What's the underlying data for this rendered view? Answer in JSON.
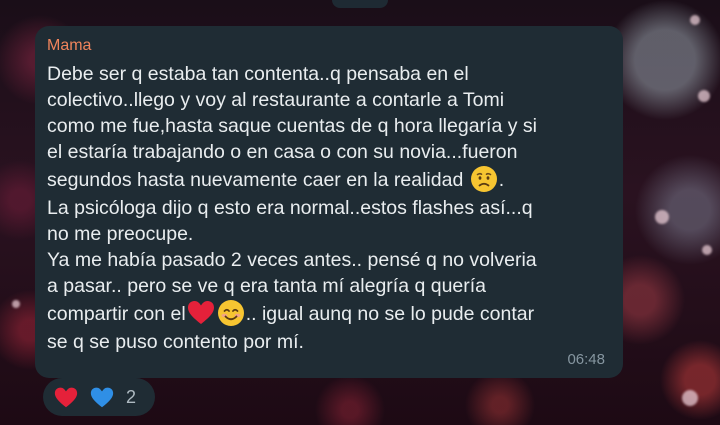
{
  "message": {
    "sender": "Mama",
    "lines": [
      "Debe ser q estaba tan contenta..q pensaba en el",
      "colectivo..llego y voy al restaurante a contarle a Tomi",
      "como me fue,hasta saque cuentas de q hora llegaría y si",
      "el estaría trabajando o en casa o con su novia...fueron",
      "segundos hasta nuevamente caer en la realidad",
      "La psicóloga dijo q esto era normal..estos flashes así...q",
      "no me preocupe.",
      "Ya me había pasado 2 veces antes.. pensé q no volveria",
      "a pasar.. pero se ve q era tanta mí alegría q quería",
      "compartir con el",
      ".. igual aunq no se lo pude contar",
      "se q se puso contento por mí."
    ],
    "time": "06:48"
  },
  "reactions": {
    "icons": [
      "red-heart-icon",
      "blue-heart-icon"
    ],
    "count": "2"
  },
  "colors": {
    "bubble": "#1f2c34",
    "sender": "#f0845c",
    "text": "#e9edef",
    "time": "#8696a0",
    "red_heart": "#e5213a",
    "blue_heart": "#2f8fe6"
  }
}
